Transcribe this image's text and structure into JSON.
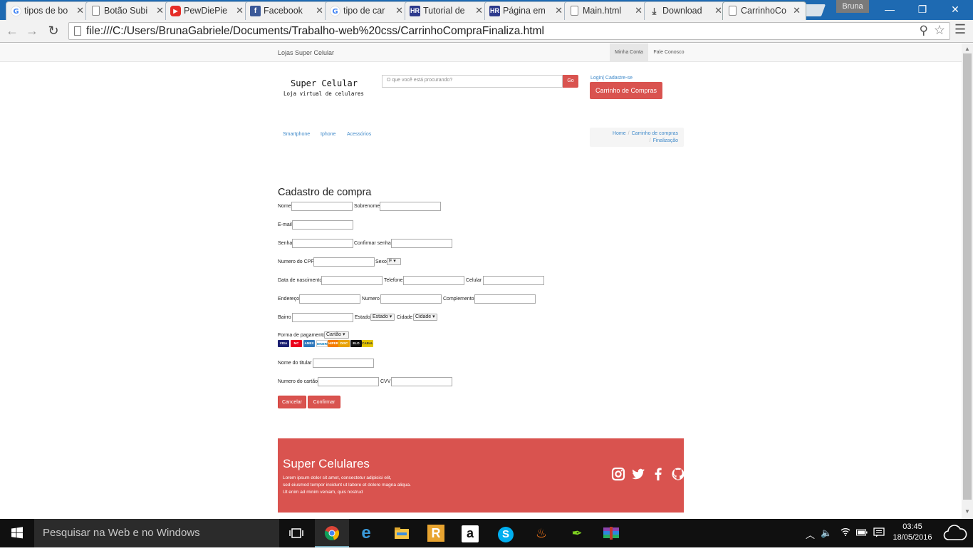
{
  "browser": {
    "tabs": [
      {
        "title": "tipos de bo",
        "icon": "google-icon"
      },
      {
        "title": "Botão Subi",
        "icon": "page-icon"
      },
      {
        "title": "PewDiePie",
        "icon": "youtube-icon"
      },
      {
        "title": "Facebook",
        "icon": "facebook-icon"
      },
      {
        "title": "tipo de car",
        "icon": "google-icon"
      },
      {
        "title": "Tutorial de",
        "icon": "hr-icon"
      },
      {
        "title": "Página em",
        "icon": "hr-icon"
      },
      {
        "title": "Main.html",
        "icon": "page-icon"
      },
      {
        "title": "Download",
        "icon": "download-icon"
      },
      {
        "title": "CarrinhoCo",
        "icon": "page-icon"
      }
    ],
    "profile_name": "Bruna",
    "url": "file:///C:/Users/BrunaGabriele/Documents/Trabalho-web%20css/CarrinhoCompraFinaliza.html"
  },
  "site": {
    "top_brand": "Lojas Super Celular",
    "top_nav": {
      "account": "Minha Conta",
      "contact": "Fale Conosco"
    },
    "logo": {
      "title": "Super Celular",
      "subtitle": "Loja virtual de celulares"
    },
    "search": {
      "placeholder": "O que você está procurando?",
      "button": "Go"
    },
    "login_text": "Login| Cadastre-se",
    "cart_button": "Carrinho de Compras",
    "categories": [
      "Smartphone",
      "Iphone",
      "Acessórios"
    ],
    "breadcrumb": [
      "Home",
      "Carrinho de compras",
      "Finalização"
    ]
  },
  "form": {
    "title": "Cadastro de compra",
    "labels": {
      "nome": "Nome",
      "sobrenome": "Sobrenome",
      "email": "E-mail",
      "senha": "Senha",
      "confirmar_senha": "Confirmar senha",
      "cpf": "Numero do CPF",
      "sexo": "Sexo",
      "nascimento": "Data de nascimento",
      "telefone": "Telefone",
      "celular": "Celular",
      "endereco": "Endereço",
      "numero": "Numero",
      "complemento": "Complemento",
      "bairro": "Bairro",
      "estado": "Estado",
      "cidade": "Cidade",
      "pagamento": "Forma de pagamento",
      "titular": "Nome do titular",
      "numero_cartao": "Numero do cartão",
      "cvv": "CVV"
    },
    "selects": {
      "sexo": "F",
      "estado": "Estado",
      "cidade": "Cidade",
      "pagamento": "Cartão"
    },
    "card_logos": [
      "VISA",
      "MC",
      "AMEX",
      "DINERS",
      "HIPER",
      "DISC",
      "ELO",
      "CABAL"
    ],
    "buttons": {
      "cancel": "Cancelar",
      "confirm": "Confirmar"
    }
  },
  "footer": {
    "title": "Super Celulares",
    "lines": [
      "Lorem ipsum dolor sit amet, consectetur adipisici elit,",
      "sed eiusmod tempor incidunt ut labore et dolore magna aliqua.",
      "Ut enim ad minim veniam, quis nostrud"
    ],
    "social_icons": [
      "instagram-icon",
      "twitter-icon",
      "facebook-icon",
      "github-icon"
    ]
  },
  "taskbar": {
    "search_placeholder": "Pesquisar na Web e no Windows",
    "time": "03:45",
    "date": "18/05/2016"
  },
  "colors": {
    "accent": "#d9534f",
    "link": "#428bca",
    "taskbar": "#101010",
    "chrome_frame": "#1e6ab2"
  }
}
